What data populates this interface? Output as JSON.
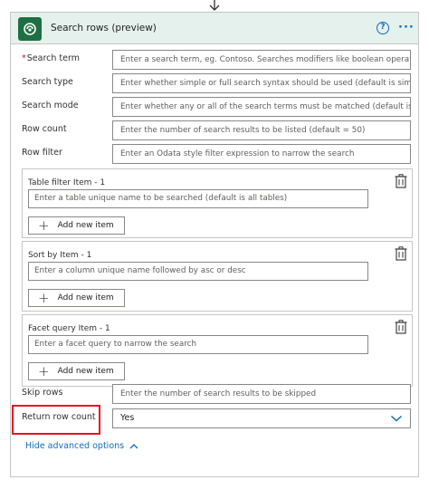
{
  "header": {
    "title": "Search rows (preview)",
    "help_glyph": "?",
    "more_glyph": "···"
  },
  "fields": {
    "search_term": {
      "required_mark": "*",
      "label": "Search term",
      "placeholder": "Enter a search term, eg. Contoso. Searches modifiers like boolean operators, wil"
    },
    "search_type": {
      "label": "Search type",
      "placeholder": "Enter whether simple or full search syntax should be used (default is simple)"
    },
    "search_mode": {
      "label": "Search mode",
      "placeholder": "Enter whether any or all of the search terms must be matched (default is any)"
    },
    "row_count": {
      "label": "Row count",
      "placeholder": "Enter the number of search results to be listed (default = 50)"
    },
    "row_filter": {
      "label": "Row filter",
      "placeholder": "Enter an Odata style filter expression to narrow the search"
    },
    "skip_rows": {
      "label": "Skip rows",
      "placeholder": "Enter the number of search results to be skipped"
    },
    "return_row_count": {
      "label": "Return row count",
      "value": "Yes"
    }
  },
  "groups": {
    "table_filter": {
      "label": "Table filter Item - 1",
      "placeholder": "Enter a table unique name to be searched (default is all tables)",
      "add_label": "Add new item"
    },
    "sort_by": {
      "label": "Sort by Item - 1",
      "placeholder": "Enter a column unique name followed by asc or desc",
      "add_label": "Add new item"
    },
    "facet_query": {
      "label": "Facet query Item - 1",
      "placeholder": "Enter a facet query to narrow the search",
      "add_label": "Add new item"
    }
  },
  "advanced_link": "Hide advanced options",
  "colors": {
    "header_bg": "#e5f1ec",
    "accent": "#0f6cbd",
    "app_icon": "#1f6f43",
    "highlight": "#e81123"
  },
  "icons": [
    "down-arrow-icon",
    "dataverse-icon",
    "help-icon",
    "more-icon",
    "delete-icon",
    "plus-icon",
    "chevron-down-icon",
    "chevron-up-icon"
  ]
}
